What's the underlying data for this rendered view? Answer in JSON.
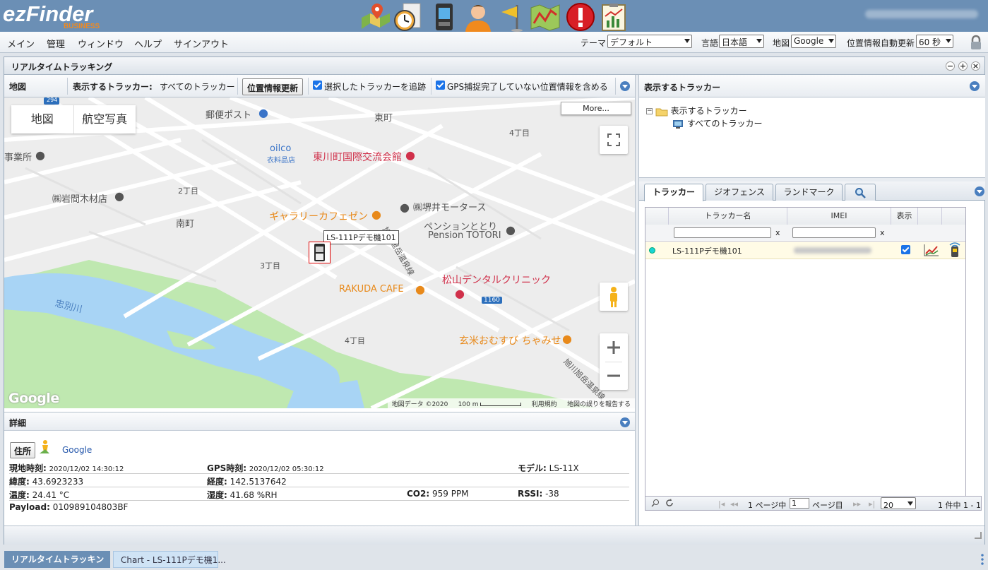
{
  "app": {
    "logo_text": "ezFinder",
    "logo_sub": "BUSINESS",
    "header_icons": [
      "map-pin-icon",
      "stopwatch-icon",
      "tracker-device-icon",
      "person-icon",
      "flag-icon",
      "route-map-icon",
      "alert-icon",
      "report-chart-icon"
    ]
  },
  "menu": {
    "items": [
      "メイン",
      "管理",
      "ウィンドウ",
      "ヘルプ",
      "サインアウト"
    ],
    "theme_label": "テーマ",
    "theme_value": "デフォルト",
    "language_label": "言語",
    "language_value": "日本語",
    "map_label": "地図",
    "map_value": "Google",
    "auto_update_label": "位置情報自動更新",
    "auto_update_value": "60 秒"
  },
  "main_panel": {
    "title": "リアルタイムトラッキング",
    "buttons": [
      "−",
      "+",
      "×"
    ]
  },
  "map_toolbar": {
    "map_label": "地図",
    "trackers_label": "表示するトラッカー:",
    "trackers_value": "すべてのトラッカー",
    "refresh_button": "位置情報更新",
    "follow_label": "選択したトラッカーを追跡",
    "include_gps_label": "GPS捕捉完了していない位置情報を含める"
  },
  "map": {
    "type_map": "地図",
    "type_satellite": "航空写真",
    "more_button": "More...",
    "tracker_marker_label": "LS-111Pデモ機101",
    "attribution": "地図データ ©2020",
    "scale": "100 m",
    "terms": "利用規約",
    "report": "地図の誤りを報告する",
    "google": "Google",
    "labels": {
      "post_office": "郵便ポスト",
      "higashi": "東町",
      "chome4_top": "4丁目",
      "jigyosho": "事業所",
      "oilco": "oilco",
      "oilco_sub": "衣料品店",
      "kokusai": "東川町国際交流会館",
      "chome2": "2丁目",
      "iwama": "㈱岩間木材店",
      "sakai": "㈱堺井モータース",
      "gallery": "ギャラリーカフェゼン",
      "minami": "南町",
      "pension1": "ペンションととり",
      "pension2": "Pension TOTORI",
      "onsen_road": "旭川旭岳温泉線",
      "chome3": "3丁目",
      "matsuyama": "松山デンタルクリニック",
      "rakuda": "RAKUDA CAFE",
      "chubetsu": "忠別川",
      "route": "1160",
      "chome4_bottom": "4丁目",
      "genmai": "玄米おむすび ちゃみせ",
      "onsen_road2": "旭川旭岳温泉線",
      "route294": "294"
    }
  },
  "details": {
    "title": "詳細",
    "address_button": "住所",
    "google_link": "Google",
    "rows": [
      {
        "l1": "現地時刻:",
        "v1": "2020/12/02 14:30:12",
        "l2": "GPS時刻:",
        "v2": "2020/12/02 05:30:12",
        "l3": "モデル:",
        "v3": "LS-11X"
      },
      {
        "l1": "緯度:",
        "v1": "43.6923233",
        "l2": "経度:",
        "v2": "142.5137642"
      },
      {
        "l1": "温度:",
        "v1": "24.41 °C",
        "l2": "湿度:",
        "v2": "41.68 %RH",
        "l3": "CO2:",
        "v3": "959 PPM",
        "l4": "RSSI:",
        "v4": "-38"
      },
      {
        "l1": "Payload:",
        "v1": "010989104803BF"
      }
    ]
  },
  "right_panel": {
    "title": "表示するトラッカー",
    "tree_root": "表示するトラッカー",
    "tree_child": "すべてのトラッカー",
    "tabs": [
      "トラッカー",
      "ジオフェンス",
      "ランドマーク"
    ],
    "grid": {
      "headers": [
        "トラッカー名",
        "IMEI",
        "表示"
      ],
      "filter_clear": "x",
      "rows": [
        {
          "name": "LS-111Pデモ機101",
          "imei": "",
          "visible": true
        }
      ]
    },
    "pager": {
      "page_prefix": "1 ページ中",
      "page_value": "1",
      "page_suffix": "ページ目",
      "page_size": "20",
      "summary": "1 件中 1 - 1"
    }
  },
  "taskbar": {
    "active": "リアルタイムトラッキン",
    "inactive": "Chart - LS-111Pデモ機1..."
  },
  "colors": {
    "header_bg": "#6b8fb5",
    "accent": "#4a7fbf",
    "river": "#a8d4f5",
    "park": "#bfe8b0"
  }
}
